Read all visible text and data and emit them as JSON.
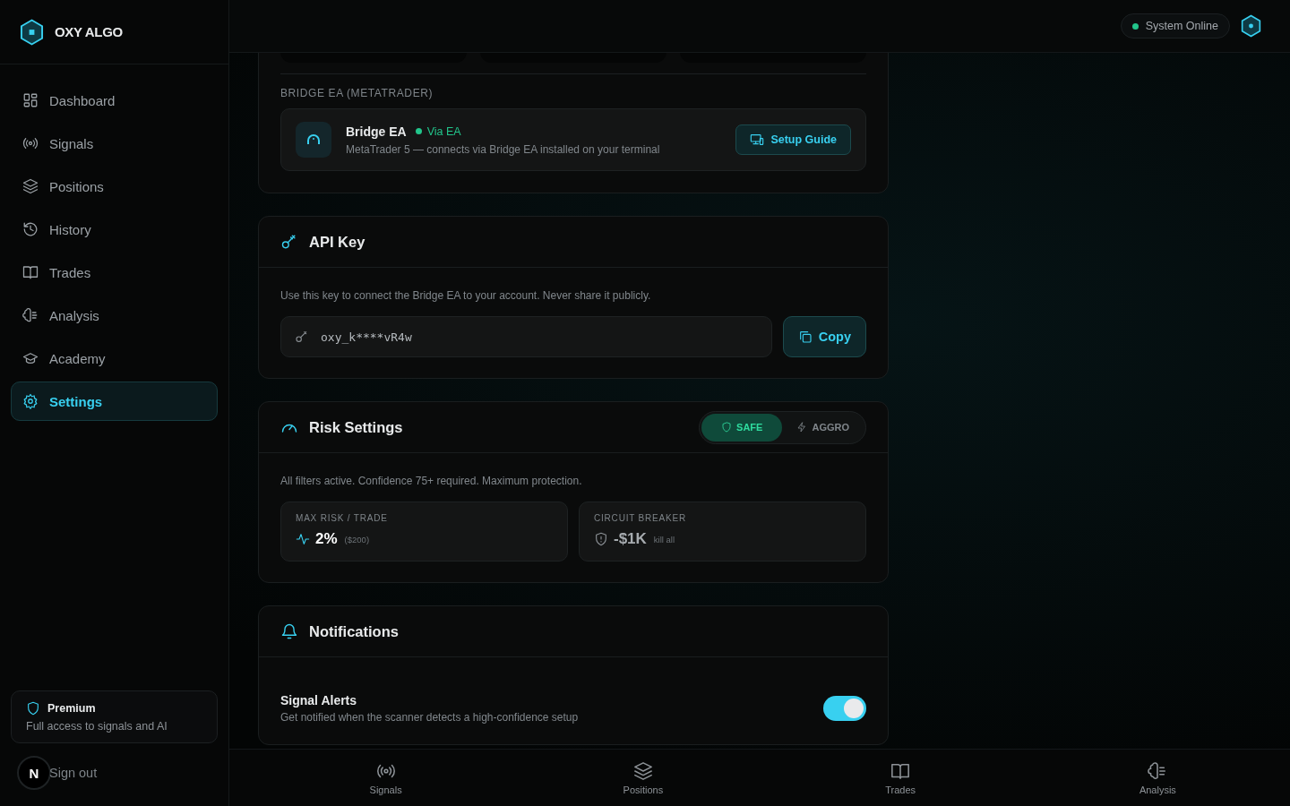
{
  "brand": {
    "name": "OXY ALGO"
  },
  "sidebar": {
    "items": [
      {
        "label": "Dashboard",
        "selected": false
      },
      {
        "label": "Signals",
        "selected": false
      },
      {
        "label": "Positions",
        "selected": false
      },
      {
        "label": "History",
        "selected": false
      },
      {
        "label": "Trades",
        "selected": false
      },
      {
        "label": "Analysis",
        "selected": false
      },
      {
        "label": "Academy",
        "selected": false
      },
      {
        "label": "Settings",
        "selected": true
      }
    ],
    "plan": {
      "title": "Premium",
      "description": "Full access to signals and AI"
    },
    "avatar": "N",
    "sign_out": "Sign out"
  },
  "top_bar": {
    "status": "System Online"
  },
  "bridge": {
    "heading": "BRIDGE EA (METATRADER)",
    "name": "Bridge EA",
    "status": "Via EA",
    "description": "MetaTrader 5 — connects via Bridge EA installed on your terminal",
    "button": "Setup Guide"
  },
  "api_key": {
    "title": "API Key",
    "hint": "Use this key to connect the Bridge EA to your account. Never share it publicly.",
    "value": "oxy_k****vR4w",
    "button": "Copy"
  },
  "risk": {
    "title": "Risk Settings",
    "modes": [
      {
        "label": "SAFE",
        "selected": true
      },
      {
        "label": "AGGRO",
        "selected": false
      }
    ],
    "description": "All filters active. Confidence 75+ required. Maximum protection.",
    "stats": [
      {
        "label": "MAX RISK / TRADE",
        "value": "2%",
        "note": "($200)"
      },
      {
        "label": "CIRCUIT BREAKER",
        "value": "-$1K",
        "note": "kill all"
      }
    ]
  },
  "notifications": {
    "title": "Notifications",
    "items": [
      {
        "title": "Signal Alerts",
        "description": "Get notified when the scanner detects a high-confidence setup",
        "on": true
      }
    ]
  },
  "bottom_nav": [
    {
      "label": "Signals"
    },
    {
      "label": "Positions"
    },
    {
      "label": "Trades"
    },
    {
      "label": "Analysis"
    }
  ]
}
